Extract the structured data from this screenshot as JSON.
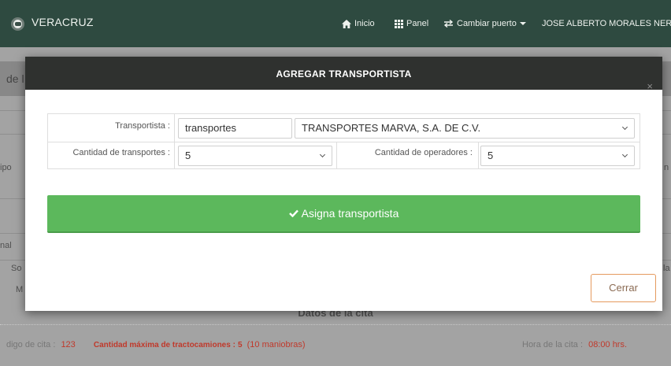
{
  "navbar": {
    "brand": "VERACRUZ",
    "home": "Inicio",
    "panel": "Panel",
    "change_port": "Cambiar puerto",
    "user": "JOSE ALBERTO MORALES NERY"
  },
  "background": {
    "header_title": "de l",
    "left_labels": [
      "ipo",
      "nal",
      "So",
      "M"
    ],
    "right_fragments": [
      "n",
      "la"
    ],
    "section_title": "Datos de la cita",
    "cita_label": "digo de cita :",
    "cita_value": "123",
    "max_label": "Cantidad máxima de tractocamiones :",
    "max_value": "5",
    "maniobras": "(10 maniobras)",
    "hora_label": "Hora de la cita :",
    "hora_value": "08:00 hrs."
  },
  "modal": {
    "title": "AGREGAR TRANSPORTISTA",
    "close_icon": "×",
    "transportista_label": "Transportista :",
    "search_value": "transportes",
    "transportista_selected": "TRANSPORTES MARVA, S.A. DE C.V.",
    "transportes_label": "Cantidad de transportes :",
    "transportes_value": "5",
    "operadores_label": "Cantidad de operadores :",
    "operadores_value": "5",
    "assign_label": "Asigna transportista",
    "close_label": "Cerrar"
  },
  "icons": {
    "logo": "port-logo-icon",
    "home": "home-icon",
    "panel": "grid-icon",
    "port": "swap-icon",
    "check": "check-icon",
    "close": "close-icon"
  },
  "colors": {
    "navbar": "#2e4a40",
    "modal_header": "#2f312f",
    "success": "#5cb85c",
    "warning_border": "#e59a5e",
    "alert_text": "#c0392b"
  }
}
